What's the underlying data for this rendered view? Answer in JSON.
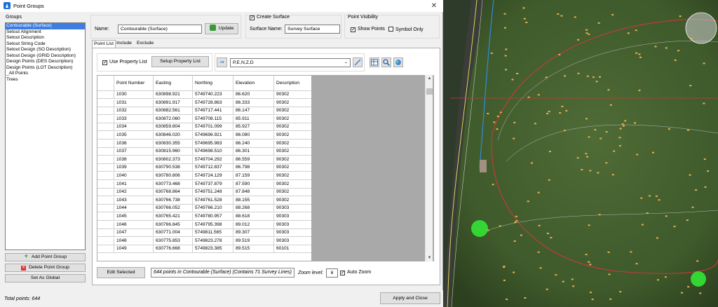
{
  "window": {
    "title": "Point Groups",
    "close_glyph": "✕"
  },
  "groups": {
    "label": "Groups",
    "items": [
      "Contourable (Surface)",
      "Setout Alignment",
      "Setout Description",
      "Setout String Code",
      "Setout Design (SO Description)",
      "Setout Design (GRID Description)",
      "Design Points (DES Description)",
      "Design Points (LOT Description)",
      "_All Points",
      "Trees"
    ],
    "selected_index": 0
  },
  "buttons": {
    "add_group": "Add Point Group",
    "delete_group": "Delete Point Group",
    "set_global": "Set As Global",
    "update": "Update",
    "setup_property_list": "Setup Property List",
    "edit_selected": "Edit Selected",
    "apply_close": "Apply and Close"
  },
  "name_field": {
    "label": "Name:",
    "value": "Contourable (Surface)"
  },
  "surface": {
    "create_label": "Create Surface",
    "create_checked": true,
    "name_label": "Surface Name:",
    "name_value": "Survey Surface"
  },
  "visibility": {
    "title": "Point Visibility",
    "show_points": "Show Points",
    "show_points_checked": true,
    "symbol_only": "Symbol Only",
    "symbol_only_checked": false
  },
  "tabs": [
    "Point List",
    "Include",
    "Exclude"
  ],
  "property_list": {
    "use_label": "Use Property List",
    "checked": true,
    "format_value": "P,E,N,Z,D"
  },
  "table": {
    "columns": [
      "Point Number",
      "Easting",
      "Northing",
      "Elevation",
      "Description"
    ],
    "rows": [
      [
        "1030",
        "630898.921",
        "5749740.223",
        "86.620",
        "90302"
      ],
      [
        "1031",
        "630891.917",
        "5749728.863",
        "86.333",
        "90302"
      ],
      [
        "1032",
        "630882.561",
        "5749717.441",
        "86.147",
        "90302"
      ],
      [
        "1033",
        "630872.060",
        "5749708.115",
        "85.911",
        "90302"
      ],
      [
        "1034",
        "630859.804",
        "5749701.099",
        "85.927",
        "90302"
      ],
      [
        "1035",
        "630846.020",
        "5749696.921",
        "86.080",
        "90302"
      ],
      [
        "1036",
        "630830.355",
        "5749695.983",
        "86.240",
        "90302"
      ],
      [
        "1037",
        "630815.960",
        "5749698.510",
        "86.301",
        "90302"
      ],
      [
        "1038",
        "630802.373",
        "5749704.292",
        "86.559",
        "90302"
      ],
      [
        "1039",
        "630790.538",
        "5749712.837",
        "86.798",
        "90302"
      ],
      [
        "1040",
        "630780.806",
        "5749724.129",
        "87.159",
        "90302"
      ],
      [
        "1041",
        "630773.468",
        "5749737.879",
        "87.590",
        "90302"
      ],
      [
        "1042",
        "630768.864",
        "5749751.248",
        "87.848",
        "90302"
      ],
      [
        "1043",
        "630766.738",
        "5749761.528",
        "88.155",
        "90302"
      ],
      [
        "1044",
        "630766.052",
        "5749766.210",
        "88.268",
        "90303"
      ],
      [
        "1045",
        "630765.421",
        "5749780.957",
        "88.618",
        "90303"
      ],
      [
        "1046",
        "630766.845",
        "5749795.398",
        "89.012",
        "90303"
      ],
      [
        "1047",
        "630771.004",
        "5749811.565",
        "89.307",
        "90303"
      ],
      [
        "1048",
        "630775.853",
        "5749823.278",
        "89.519",
        "90303"
      ],
      [
        "1049",
        "630776.668",
        "5749823.385",
        "89.515",
        "60101"
      ]
    ]
  },
  "status": {
    "summary": "644 points in Contourable (Surface) (Contains 71 Survey Lines)",
    "zoom_label": "Zoom level:",
    "zoom_value": "6",
    "auto_zoom_label": "Auto Zoom",
    "auto_zoom_checked": true,
    "total": "Total points: 644"
  }
}
